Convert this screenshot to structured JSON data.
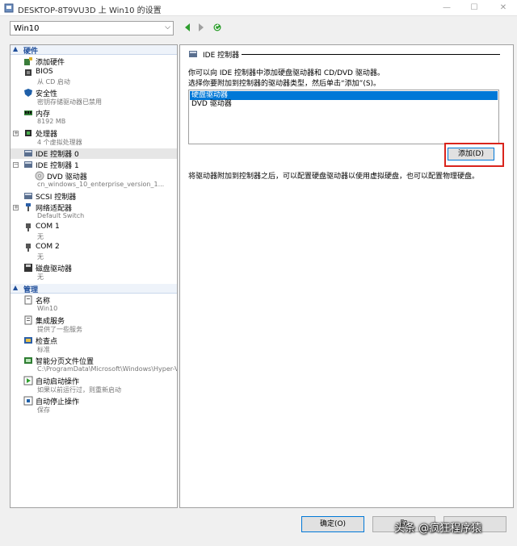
{
  "window": {
    "title": "DESKTOP-8T9VU3D 上 Win10 的设置",
    "min_glyph": "—",
    "max_glyph": "☐",
    "close_glyph": "✕"
  },
  "vm_selector": {
    "value": "Win10",
    "arrow_glyph": "⌵"
  },
  "tree": {
    "hardware_section": {
      "toggle": "▲",
      "label": "硬件"
    },
    "management_section": {
      "toggle": "▲",
      "label": "管理"
    },
    "items": {
      "add_hardware": {
        "label": "添加硬件"
      },
      "bios": {
        "label": "BIOS",
        "sub": "从 CD 启动"
      },
      "security": {
        "label": "安全性",
        "sub": "密钥存储驱动器已禁用"
      },
      "memory": {
        "label": "内存",
        "sub": "8192 MB"
      },
      "processor": {
        "expander": "+",
        "label": "处理器",
        "sub": "4 个虚拟处理器"
      },
      "ide0": {
        "label": "IDE 控制器 0"
      },
      "ide1": {
        "expander": "−",
        "label": "IDE 控制器 1"
      },
      "dvd": {
        "label": "DVD 驱动器",
        "sub": "cn_windows_10_enterprise_version_1..."
      },
      "scsi": {
        "label": "SCSI 控制器"
      },
      "network": {
        "expander": "+",
        "label": "网络适配器",
        "sub": "Default Switch"
      },
      "com1": {
        "label": "COM 1",
        "sub": "无"
      },
      "com2": {
        "label": "COM 2",
        "sub": "无"
      },
      "floppy": {
        "label": "磁盘驱动器",
        "sub": "无"
      },
      "name": {
        "label": "名称",
        "sub": "Win10"
      },
      "integration": {
        "label": "集成服务",
        "sub": "提供了一些服务"
      },
      "checkpoints": {
        "label": "检查点",
        "sub": "标准"
      },
      "paging": {
        "label": "智能分页文件位置",
        "sub": "C:\\ProgramData\\Microsoft\\Windows\\Hyper-V"
      },
      "auto_start": {
        "label": "自动启动操作",
        "sub": "如果以前运行过，则重新启动"
      },
      "auto_stop": {
        "label": "自动停止操作",
        "sub": "保存"
      }
    }
  },
  "panel": {
    "title": "IDE 控制器",
    "description_line1": "你可以向 IDE 控制器中添加硬盘驱动器和 CD/DVD 驱动器。",
    "description_line2": "选择你要附加到控制器的驱动器类型，然后单击“添加”(S)。",
    "drive_types": [
      "硬盘驱动器",
      "DVD 驱动器"
    ],
    "selected_index": 0,
    "add_button": "添加(D)",
    "footer_text": "将驱动器附加到控制器之后，可以配置硬盘驱动器以使用虚拟硬盘，也可以配置物理硬盘。"
  },
  "buttons": {
    "ok": "确定(O)",
    "cancel": "取",
    "apply": ""
  },
  "watermark": "头条 @疯狂程序猿",
  "colors": {
    "selection": "#0078d7",
    "highlight": "#d9241c",
    "section_header": "#1f4e9a"
  }
}
